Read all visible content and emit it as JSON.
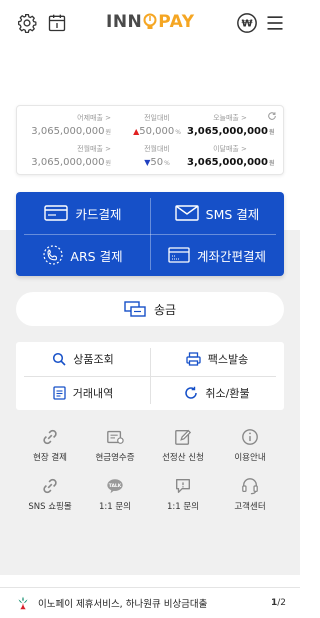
{
  "header": {
    "logo_left": "INN",
    "logo_right": "PAY",
    "icons": [
      "gear-icon",
      "calendar-icon",
      "won-currency-icon",
      "hamburger-menu-icon"
    ]
  },
  "stats": {
    "yesterday": {
      "label": "어제매출 >",
      "value": "3,065,000,000",
      "unit": "원"
    },
    "vs_yesterday": {
      "label": "전일대비",
      "arrow": "▲",
      "value": "50,000",
      "unit": "%"
    },
    "today": {
      "label": "오늘매출 >",
      "value": "3,065,000,000",
      "unit": "원"
    },
    "last_month": {
      "label": "전월매출 >",
      "value": "3,065,000,000",
      "unit": "원"
    },
    "vs_last_month": {
      "label": "전월대비",
      "arrow": "▼",
      "value": "50",
      "unit": "%"
    },
    "this_month": {
      "label": "이달매출 >",
      "value": "3,065,000,000",
      "unit": "원"
    }
  },
  "payments": {
    "card": "카드결제",
    "sms": "SMS 결제",
    "ars": "ARS 결제",
    "account": "계좌간편결제"
  },
  "transfer": {
    "label": "송금"
  },
  "menu": {
    "product": "상품조회",
    "fax": "팩스발송",
    "history": "거래내역",
    "cancel": "취소/환불"
  },
  "quick": [
    {
      "label": "현장 결제",
      "icon": "link-icon"
    },
    {
      "label": "현금영수증",
      "icon": "receipt-icon"
    },
    {
      "label": "선정산 신청",
      "icon": "edit-icon"
    },
    {
      "label": "이용안내",
      "icon": "info-icon"
    },
    {
      "label": "SNS 쇼핑몰",
      "icon": "link-icon"
    },
    {
      "label": "1:1 문의",
      "icon": "talk-icon"
    },
    {
      "label": "1:1 문의",
      "icon": "chat-icon"
    },
    {
      "label": "고객센터",
      "icon": "headset-icon"
    }
  ],
  "footer": {
    "notice": "이노페이 제휴서비스, 하나원큐 비상금대출",
    "page_current": "1",
    "page_total": "/2"
  },
  "colors": {
    "primary": "#1650c8",
    "accent": "#f5a623",
    "up": "#e02020",
    "down": "#2040c0"
  }
}
